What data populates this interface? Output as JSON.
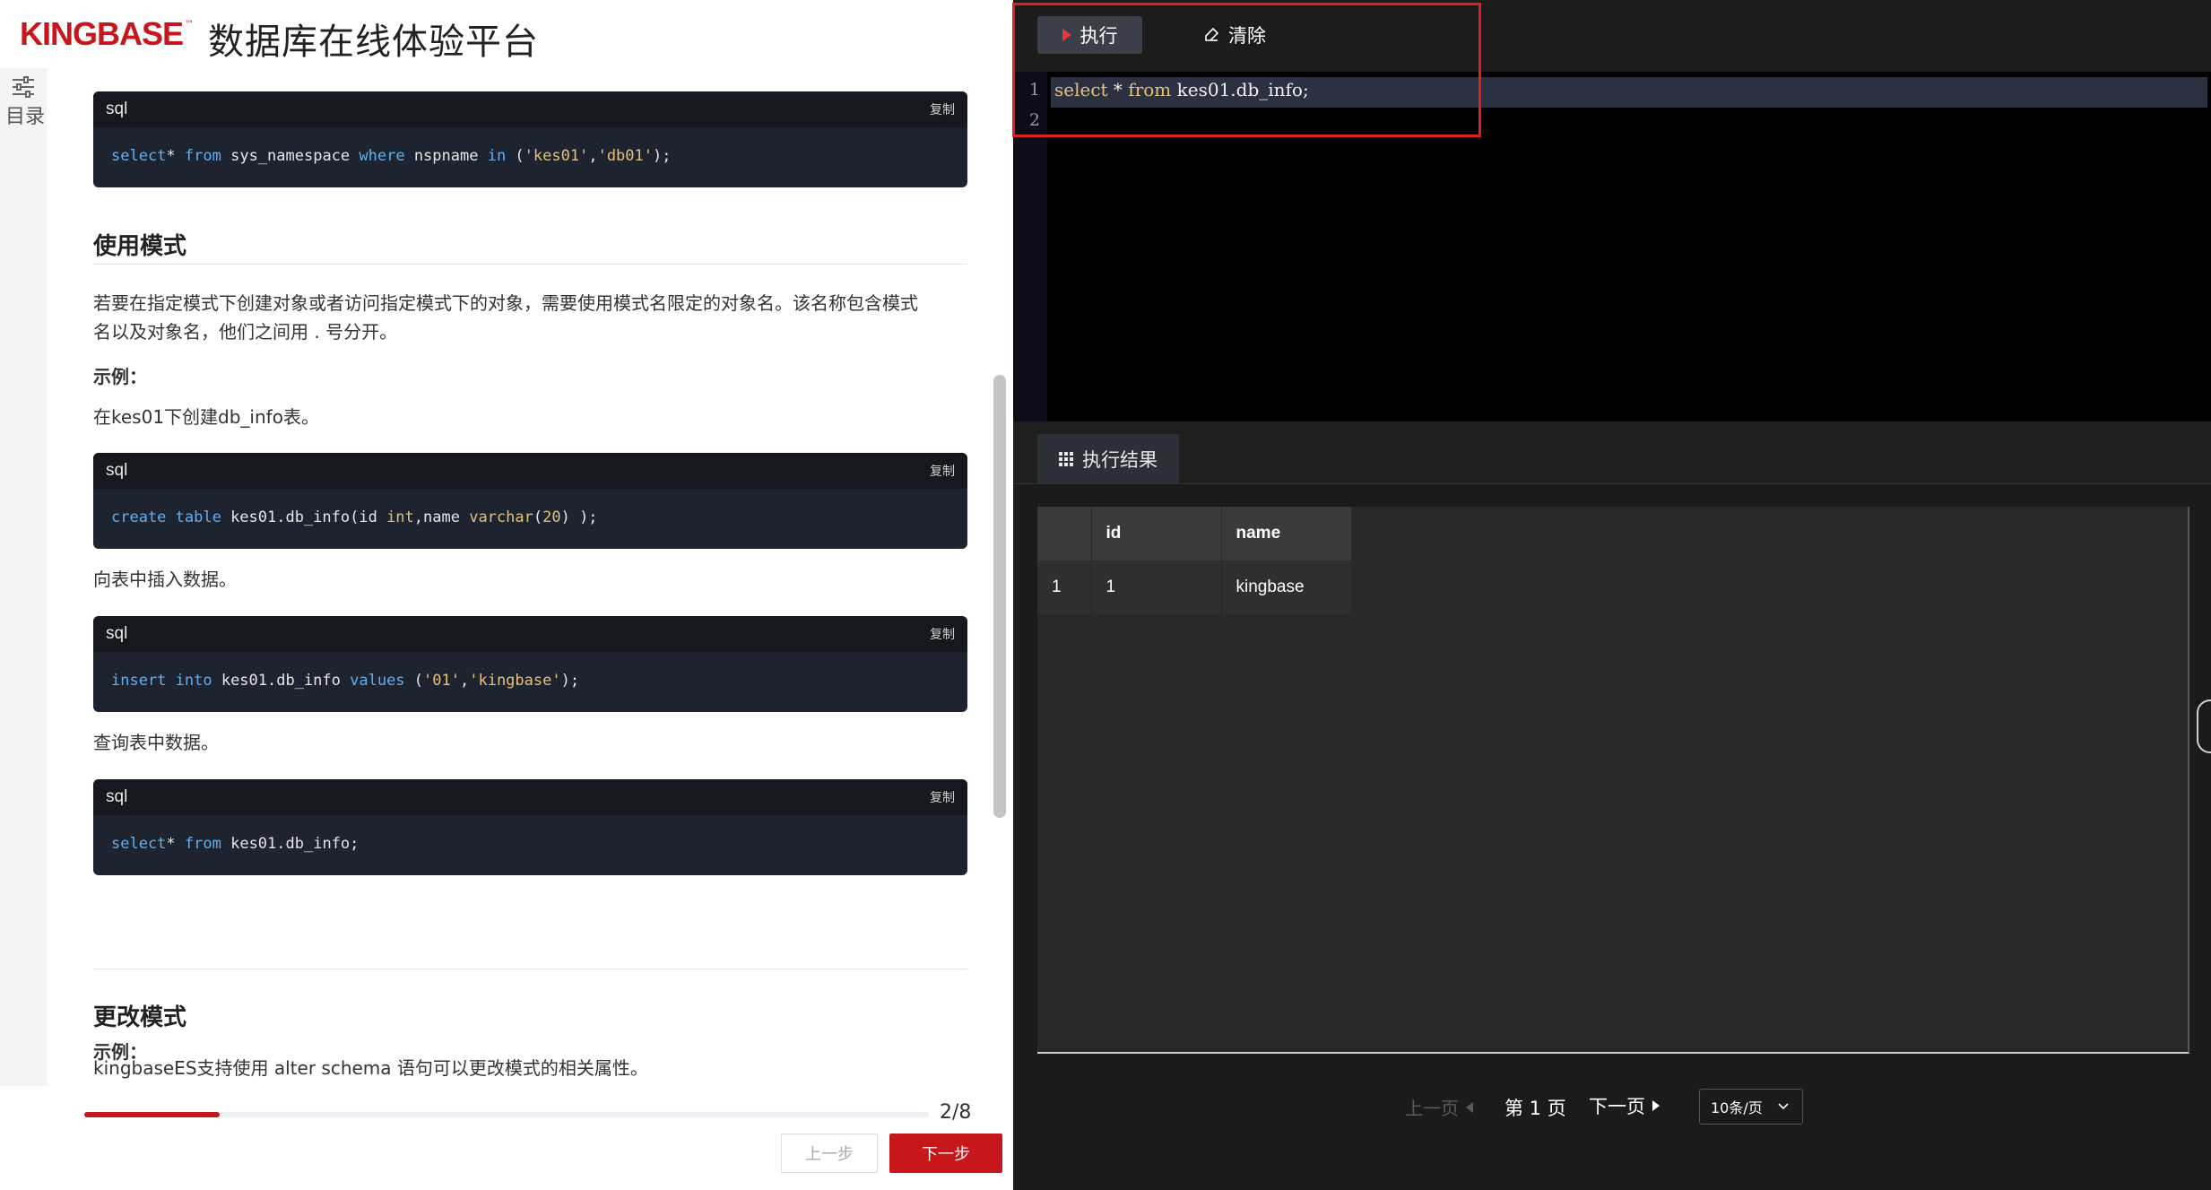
{
  "header": {
    "logo_text": "KINGBASE",
    "logo_tm": "™",
    "platform_title": "数据库在线体验平台"
  },
  "toc": {
    "label": "目录"
  },
  "content": {
    "code_blocks": [
      {
        "lang": "sql",
        "copy_label": "复制",
        "code": [
          [
            "kw",
            "select"
          ],
          [
            "",
            "* "
          ],
          [
            "kw",
            "from"
          ],
          [
            "",
            " sys_namespace "
          ],
          [
            "kw",
            "where"
          ],
          [
            "",
            " nspname "
          ],
          [
            "kw",
            "in"
          ],
          [
            "",
            " ("
          ],
          [
            "str",
            "'kes01'"
          ],
          [
            "",
            ","
          ],
          [
            "str",
            "'db01'"
          ],
          [
            "",
            ");"
          ]
        ]
      },
      {
        "lang": "sql",
        "copy_label": "复制",
        "code": [
          [
            "kw",
            "create table"
          ],
          [
            "",
            " kes01.db_info(id "
          ],
          [
            "str",
            "int"
          ],
          [
            "",
            ",name "
          ],
          [
            "str",
            "varchar"
          ],
          [
            "",
            "("
          ],
          [
            "str",
            "20"
          ],
          [
            "",
            ") );"
          ]
        ]
      },
      {
        "lang": "sql",
        "copy_label": "复制",
        "code": [
          [
            "kw",
            "insert into"
          ],
          [
            "",
            " kes01.db_info "
          ],
          [
            "kw",
            "values"
          ],
          [
            "",
            " ("
          ],
          [
            "str",
            "'01'"
          ],
          [
            "",
            ","
          ],
          [
            "str",
            "'kingbase'"
          ],
          [
            "",
            ");"
          ]
        ]
      },
      {
        "lang": "sql",
        "copy_label": "复制",
        "code": [
          [
            "kw",
            "select"
          ],
          [
            "",
            "* "
          ],
          [
            "kw",
            "from"
          ],
          [
            "",
            " kes01.db_info;"
          ]
        ]
      }
    ],
    "section1": {
      "heading": "使用模式",
      "para_line1": "若要在指定模式下创建对象或者访问指定模式下的对象，需要使用模式名限定的对象名。该名称包含模式",
      "para_line2": "名以及对象名，他们之间用 . 号分开。",
      "example_label": "示例：",
      "step1": "在kes01下创建db_info表。",
      "step2": "向表中插入数据。",
      "step3": "查询表中数据。"
    },
    "section2": {
      "heading": "更改模式",
      "para": "kingbaseES支持使用 alter schema 语句可以更改模式的相关属性。",
      "example_label": "示例："
    }
  },
  "footer": {
    "progress_text": "2/8",
    "progress_fraction": 0.16,
    "prev_label": "上一步",
    "next_label": "下一步"
  },
  "editor": {
    "run_label": "执行",
    "clear_label": "清除",
    "line_numbers": [
      "1",
      "2"
    ],
    "code_tokens": [
      [
        "k",
        "select"
      ],
      [
        "",
        " * "
      ],
      [
        "k",
        "from"
      ],
      [
        "",
        " kes01.db_info;"
      ]
    ]
  },
  "results": {
    "tab_label": "执行结果",
    "columns": [
      "",
      "id",
      "name"
    ],
    "rows": [
      [
        "1",
        "1",
        "kingbase"
      ]
    ]
  },
  "pagination": {
    "prev_label": "上一页",
    "current_label": "第 1 页",
    "next_label": "下一页",
    "page_size_label": "10条/页"
  },
  "colors": {
    "brand_red": "#c8161d",
    "highlight_red": "#e0201e",
    "editor_bg": "#000000",
    "code_bg": "#1e2330"
  }
}
